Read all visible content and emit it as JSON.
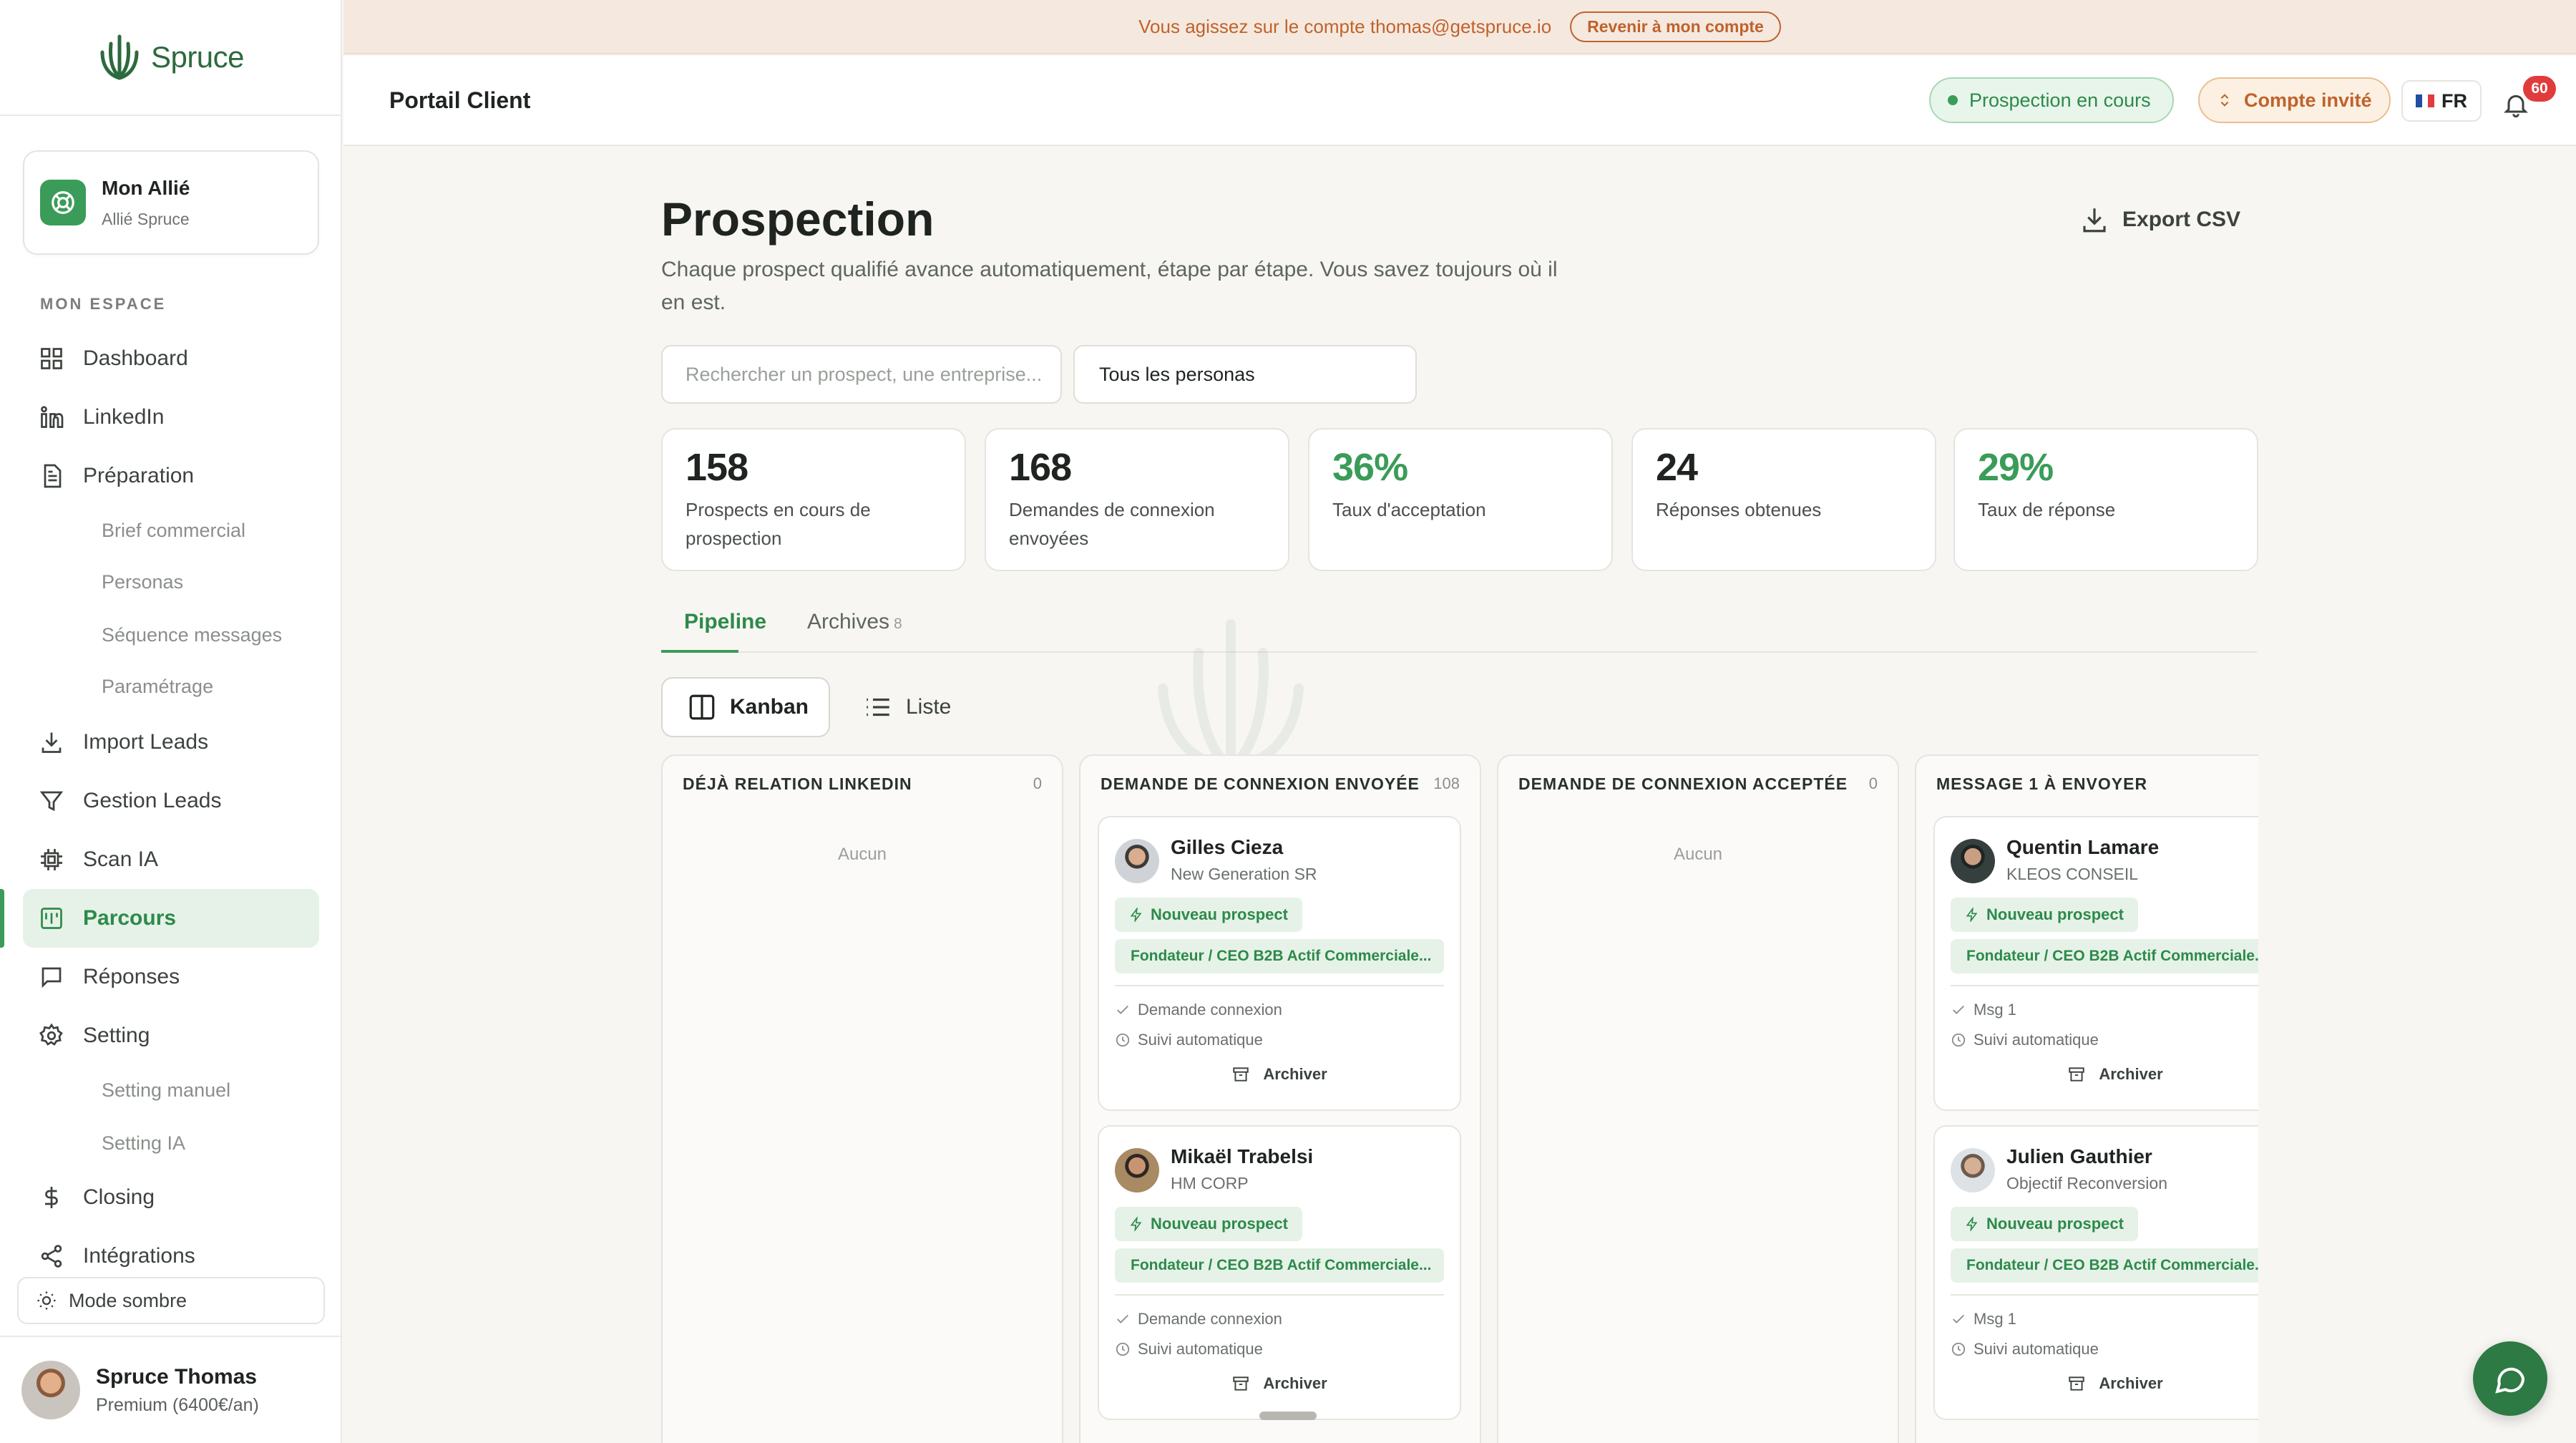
{
  "brand": {
    "name": "Spruce",
    "color": "#2d6a3e",
    "accent": "#3a9c58"
  },
  "ally": {
    "title": "Mon Allié",
    "subtitle": "Allié Spruce"
  },
  "sidebar": {
    "section_label": "MON ESPACE",
    "items": [
      {
        "label": "Dashboard",
        "icon": "grid-icon"
      },
      {
        "label": "LinkedIn",
        "icon": "linkedin-icon"
      },
      {
        "label": "Préparation",
        "icon": "document-icon"
      },
      {
        "label": "Import Leads",
        "icon": "download-icon"
      },
      {
        "label": "Gestion Leads",
        "icon": "filter-icon"
      },
      {
        "label": "Scan IA",
        "icon": "chip-icon"
      },
      {
        "label": "Parcours",
        "icon": "kanban-icon",
        "active": true
      },
      {
        "label": "Réponses",
        "icon": "chat-icon"
      },
      {
        "label": "Setting",
        "icon": "gear-icon"
      },
      {
        "label": "Closing",
        "icon": "dollar-icon"
      },
      {
        "label": "Intégrations",
        "icon": "share-icon"
      }
    ],
    "preparation_sub": [
      "Brief commercial",
      "Personas",
      "Séquence messages",
      "Paramétrage"
    ],
    "setting_sub": [
      "Setting manuel",
      "Setting IA"
    ],
    "dark_mode": "Mode sombre"
  },
  "user": {
    "name": "Spruce Thomas",
    "plan": "Premium (6400€/an)"
  },
  "banner": {
    "text": "Vous agissez sur le compte thomas@getspruce.io",
    "button": "Revenir à mon compte"
  },
  "header": {
    "title": "Portail Client",
    "status_pill": "Prospection en cours",
    "guest_pill": "Compte invité",
    "language": "FR",
    "notifications": "60"
  },
  "page": {
    "title": "Prospection",
    "description": "Chaque prospect qualifié avance automatiquement, étape par étape. Vous savez toujours où il en est.",
    "export_label": "Export CSV",
    "search_placeholder": "Rechercher un prospect, une entreprise...",
    "persona_filter": "Tous les personas"
  },
  "stats": [
    {
      "value": "158",
      "label": "Prospects en cours de prospection",
      "green": false
    },
    {
      "value": "168",
      "label": "Demandes de connexion envoyées",
      "green": false
    },
    {
      "value": "36%",
      "label": "Taux d'acceptation",
      "green": true
    },
    {
      "value": "24",
      "label": "Réponses obtenues",
      "green": false
    },
    {
      "value": "29%",
      "label": "Taux de réponse",
      "green": true
    }
  ],
  "tabs": {
    "pipeline": "Pipeline",
    "archives": "Archives",
    "archives_count": "8"
  },
  "views": {
    "kanban": "Kanban",
    "list": "Liste"
  },
  "columns": [
    {
      "title": "DÉJÀ RELATION LINKEDIN",
      "count": "0",
      "empty": "Aucun",
      "cards": []
    },
    {
      "title": "DEMANDE DE CONNEXION ENVOYÉE",
      "count": "108",
      "cards": [
        {
          "name": "Gilles Cieza",
          "company": "New Generation SR",
          "tag": "Nouveau prospect",
          "persona": "Fondateur / CEO B2B Actif Commerciale...",
          "line1": "Demande connexion",
          "line2": "Suivi automatique",
          "archive": "Archiver"
        },
        {
          "name": "Mikaël Trabelsi",
          "company": "HM CORP",
          "tag": "Nouveau prospect",
          "persona": "Fondateur / CEO B2B Actif Commerciale...",
          "line1": "Demande connexion",
          "line2": "Suivi automatique",
          "archive": "Archiver"
        }
      ]
    },
    {
      "title": "DEMANDE DE CONNEXION ACCEPTÉE",
      "count": "0",
      "empty": "Aucun",
      "cards": []
    },
    {
      "title": "MESSAGE 1 À ENVOYER",
      "count": "",
      "cards": [
        {
          "name": "Quentin Lamare",
          "company": "KLEOS CONSEIL",
          "tag": "Nouveau prospect",
          "persona": "Fondateur / CEO B2B Actif Commerciale...",
          "line1": "Msg 1",
          "line2": "Suivi automatique",
          "archive": "Archiver"
        },
        {
          "name": "Julien Gauthier",
          "company": "Objectif Reconversion",
          "tag": "Nouveau prospect",
          "persona": "Fondateur / CEO B2B Actif Commerciale...",
          "line1": "Msg 1",
          "line2": "Suivi automatique",
          "archive": "Archiver"
        }
      ]
    }
  ]
}
